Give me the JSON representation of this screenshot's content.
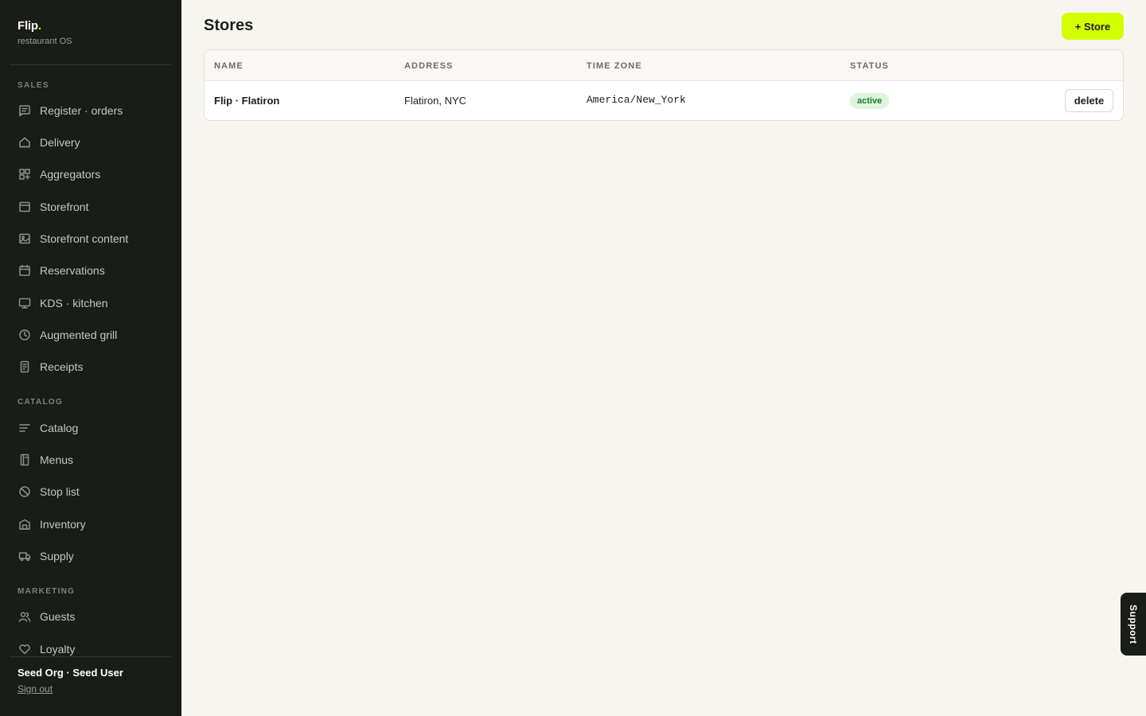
{
  "brand": {
    "name": "Flip",
    "dot": ".",
    "subtitle": "restaurant OS"
  },
  "sidebar": {
    "sections": [
      {
        "title": "SALES",
        "items": [
          {
            "label": "Register · orders",
            "icon": "receipt-chat-icon"
          },
          {
            "label": "Delivery",
            "icon": "home-icon"
          },
          {
            "label": "Aggregators",
            "icon": "grid-plus-icon"
          },
          {
            "label": "Storefront",
            "icon": "window-icon"
          },
          {
            "label": "Storefront content",
            "icon": "image-icon"
          },
          {
            "label": "Reservations",
            "icon": "calendar-icon"
          },
          {
            "label": "KDS · kitchen",
            "icon": "monitor-icon"
          },
          {
            "label": "Augmented grill",
            "icon": "clock-icon"
          },
          {
            "label": "Receipts",
            "icon": "document-icon"
          }
        ]
      },
      {
        "title": "CATALOG",
        "items": [
          {
            "label": "Catalog",
            "icon": "list-icon"
          },
          {
            "label": "Menus",
            "icon": "menu-book-icon"
          },
          {
            "label": "Stop list",
            "icon": "ban-icon"
          },
          {
            "label": "Inventory",
            "icon": "warehouse-icon"
          },
          {
            "label": "Supply",
            "icon": "truck-icon"
          }
        ]
      },
      {
        "title": "MARKETING",
        "items": [
          {
            "label": "Guests",
            "icon": "users-icon"
          },
          {
            "label": "Loyalty",
            "icon": "heart-icon"
          }
        ]
      }
    ],
    "user": {
      "name": "Seed Org · Seed User",
      "signout": "Sign out"
    }
  },
  "main": {
    "title": "Stores",
    "add_button": "+ Store",
    "table": {
      "columns": [
        "NAME",
        "ADDRESS",
        "TIME ZONE",
        "STATUS"
      ],
      "rows": [
        {
          "name": "Flip · Flatiron",
          "address": "Flatiron, NYC",
          "timezone": "America/New_York",
          "status": "active",
          "action": "delete"
        }
      ]
    }
  },
  "support_tab": "Support",
  "colors": {
    "accent": "#d4ff00",
    "sidebar_bg": "#1a1c17",
    "status_active_bg": "#dcf5dc",
    "status_active_text": "#1e7a36"
  }
}
